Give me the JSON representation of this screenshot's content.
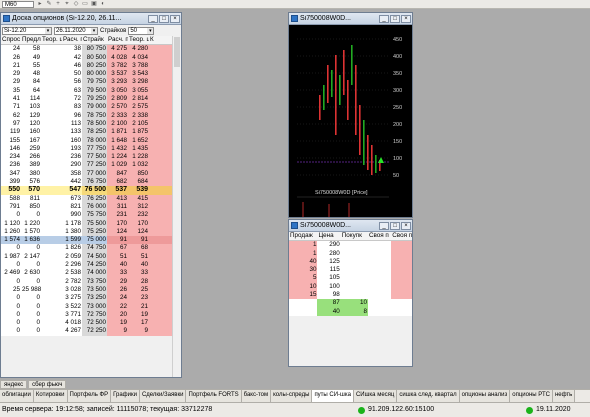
{
  "toolbar": {
    "combo_value": "M60"
  },
  "desk": {
    "title": "Доска опционов (Si-12.20, 26.11...",
    "series": "Si-12.20",
    "date": "26.11.2020",
    "strikes_label": "Страйков",
    "strikes_count": "50",
    "headers": [
      "Спрос",
      "Предл",
      "Теор. цена",
      "Расч. п",
      "Страйк",
      "Расч. п",
      "Теор. цена",
      "К"
    ],
    "rows": [
      [
        "24",
        "58",
        "",
        "38",
        "80 750",
        "4 275",
        "4 280"
      ],
      [
        "26",
        "49",
        "",
        "42",
        "80 500",
        "4 028",
        "4 034"
      ],
      [
        "21",
        "55",
        "",
        "46",
        "80 250",
        "3 782",
        "3 788"
      ],
      [
        "29",
        "48",
        "",
        "50",
        "80 000",
        "3 537",
        "3 543"
      ],
      [
        "29",
        "84",
        "",
        "56",
        "79 750",
        "3 293",
        "3 298"
      ],
      [
        "35",
        "64",
        "",
        "63",
        "79 500",
        "3 050",
        "3 055"
      ],
      [
        "41",
        "114",
        "",
        "72",
        "79 250",
        "2 809",
        "2 814"
      ],
      [
        "71",
        "103",
        "",
        "83",
        "79 000",
        "2 570",
        "2 575"
      ],
      [
        "62",
        "129",
        "",
        "96",
        "78 750",
        "2 333",
        "2 338"
      ],
      [
        "97",
        "120",
        "",
        "113",
        "78 500",
        "2 100",
        "2 105"
      ],
      [
        "119",
        "160",
        "",
        "133",
        "78 250",
        "1 871",
        "1 875"
      ],
      [
        "155",
        "167",
        "",
        "160",
        "78 000",
        "1 648",
        "1 652"
      ],
      [
        "146",
        "259",
        "",
        "193",
        "77 750",
        "1 432",
        "1 435"
      ],
      [
        "234",
        "266",
        "",
        "236",
        "77 500",
        "1 224",
        "1 228"
      ],
      [
        "236",
        "389",
        "",
        "290",
        "77 250",
        "1 029",
        "1 032"
      ],
      [
        "347",
        "380",
        "",
        "358",
        "77 000",
        "847",
        "850"
      ],
      [
        "399",
        "576",
        "",
        "442",
        "76 750",
        "682",
        "684"
      ],
      [
        "550",
        "570",
        "",
        "547",
        "76 500",
        "537",
        "539"
      ],
      [
        "588",
        "811",
        "",
        "673",
        "76 250",
        "413",
        "415"
      ],
      [
        "791",
        "850",
        "",
        "821",
        "76 000",
        "311",
        "312"
      ],
      [
        "0",
        "0",
        "",
        "990",
        "75 750",
        "231",
        "232"
      ],
      [
        "1 120",
        "1 220",
        "",
        "1 178",
        "75 500",
        "170",
        "170"
      ],
      [
        "1 260",
        "1 570",
        "",
        "1 380",
        "75 250",
        "124",
        "124"
      ],
      [
        "1 574",
        "1 636",
        "",
        "1 599",
        "75 000",
        "91",
        "91"
      ],
      [
        "0",
        "0",
        "",
        "1 826",
        "74 750",
        "67",
        "68"
      ],
      [
        "1 987",
        "2 147",
        "",
        "2 059",
        "74 500",
        "51",
        "51"
      ],
      [
        "0",
        "0",
        "",
        "2 296",
        "74 250",
        "40",
        "40"
      ],
      [
        "2 469",
        "2 630",
        "",
        "2 538",
        "74 000",
        "33",
        "33"
      ],
      [
        "0",
        "0",
        "",
        "2 782",
        "73 750",
        "29",
        "28"
      ],
      [
        "25",
        "25 988",
        "",
        "3 028",
        "73 500",
        "26",
        "25"
      ],
      [
        "0",
        "0",
        "",
        "3 275",
        "73 250",
        "24",
        "23"
      ],
      [
        "0",
        "0",
        "",
        "3 522",
        "73 000",
        "22",
        "21"
      ],
      [
        "0",
        "0",
        "",
        "3 771",
        "72 750",
        "20",
        "19"
      ],
      [
        "0",
        "0",
        "",
        "4 018",
        "72 500",
        "19",
        "17"
      ],
      [
        "0",
        "0",
        "",
        "4 267",
        "72 250",
        "9",
        "9"
      ]
    ]
  },
  "chart": {
    "title": "Si750008W0D...",
    "legend": "Si750008W0D [Price]",
    "price_axis": [
      "450",
      "400",
      "350",
      "300",
      "250",
      "200",
      "150",
      "100",
      "50"
    ]
  },
  "dom": {
    "title": "Si750008W0D...",
    "headers": [
      "Продаж",
      "Цена",
      "Покупк",
      "Своя п",
      "Своя п"
    ],
    "asks": [
      [
        "1",
        "290"
      ],
      [
        "1",
        "280"
      ],
      [
        "40",
        "125"
      ],
      [
        "30",
        "115"
      ],
      [
        "5",
        "105"
      ],
      [
        "10",
        "100"
      ],
      [
        "15",
        "98"
      ]
    ],
    "bids": [
      [
        "87",
        "10"
      ],
      [
        "40",
        "8"
      ]
    ]
  },
  "subtabs": [
    "яндекс",
    "сбер фьюч"
  ],
  "tabs": [
    "облигации",
    "Котировки",
    "Портфель ФР",
    "Графики",
    "Сделки/Заявки",
    "Портфель FORTS",
    "бакс-том",
    "колы-спреды",
    "путы СИ-шка",
    "СИшка месяц",
    "сишка след. квартал",
    "опционы анализ",
    "опционы РТС",
    "нефть"
  ],
  "status": {
    "left": "Время сервера: 19:12:58; записей: 11115078; текущая: 33712278",
    "server": "91.209.122.60:15100",
    "date": "19.11.2020",
    "colors": {
      "green": "#1bb31b"
    }
  }
}
